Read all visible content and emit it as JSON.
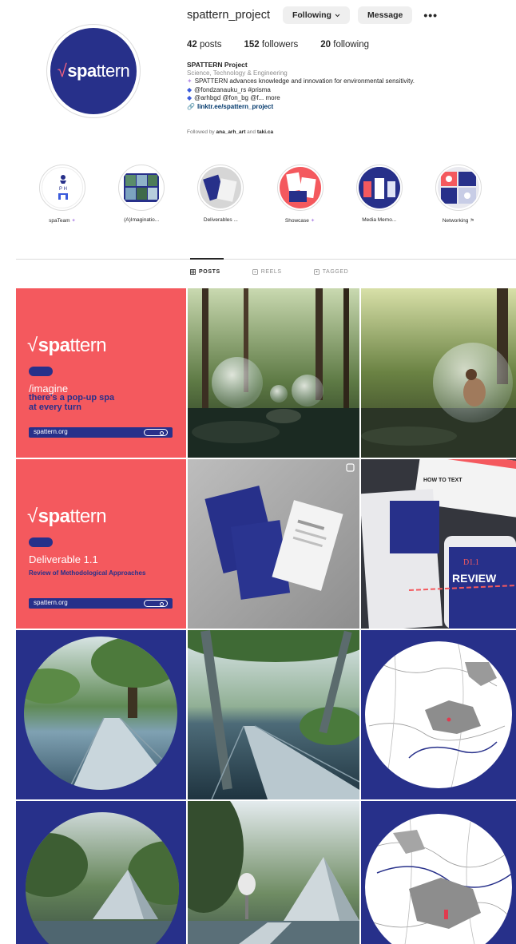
{
  "profile": {
    "username": "spattern_project",
    "following_button": "Following",
    "message_button": "Message",
    "more": "•••",
    "avatar_logo": {
      "hook": "√",
      "bold": "spa",
      "rest": "ttern"
    }
  },
  "stats": {
    "posts_count": "42",
    "posts_label": "posts",
    "followers_count": "152",
    "followers_label": "followers",
    "following_count": "20",
    "following_label": "following"
  },
  "bio": {
    "name": "SPATTERN Project",
    "category": "Science, Technology & Engineering",
    "tagline": "SPATTERN advances knowledge and innovation for environmental sensitivity.",
    "line1": "@fondzanauku_rs #prisma",
    "line2": "@arhbgd @fon_bg @f... more",
    "link": "linktr.ee/spattern_project",
    "followed_prefix": "Followed by",
    "followed_user1": "ana_arh_art",
    "followed_and": "and",
    "followed_user2": "taki.ca"
  },
  "highlights": [
    {
      "label": "spaTeam"
    },
    {
      "label": "(A)Imaginatio..."
    },
    {
      "label": "Deliverables ..."
    },
    {
      "label": "Showcase"
    },
    {
      "label": "Media Memo..."
    },
    {
      "label": "Networking"
    }
  ],
  "tabs": [
    {
      "label": "POSTS",
      "icon": "grid-icon"
    },
    {
      "label": "REELS",
      "icon": "reels-icon"
    },
    {
      "label": "TAGGED",
      "icon": "tagged-icon"
    }
  ],
  "posts": {
    "post1": {
      "logo_bold": "spa",
      "logo_rest": "ttern",
      "kicker": "/imagine",
      "headline_line1": "there's a pop-up spa",
      "headline_line2": "at every turn",
      "url": "spattern.org"
    },
    "post4": {
      "logo_bold": "spa",
      "logo_rest": "ttern",
      "title": "Deliverable 1.1",
      "subtitle": "Review of Methodological Approaches",
      "url": "spattern.org"
    },
    "post6": {
      "book_title": "HOW TO TEXT",
      "cover_label": "REVIEW",
      "cover_code": "D1.1"
    }
  },
  "colors": {
    "brand_navy": "#27308a",
    "brand_coral": "#f4595e",
    "link": "#00376b",
    "muted": "#8e8e8e"
  }
}
